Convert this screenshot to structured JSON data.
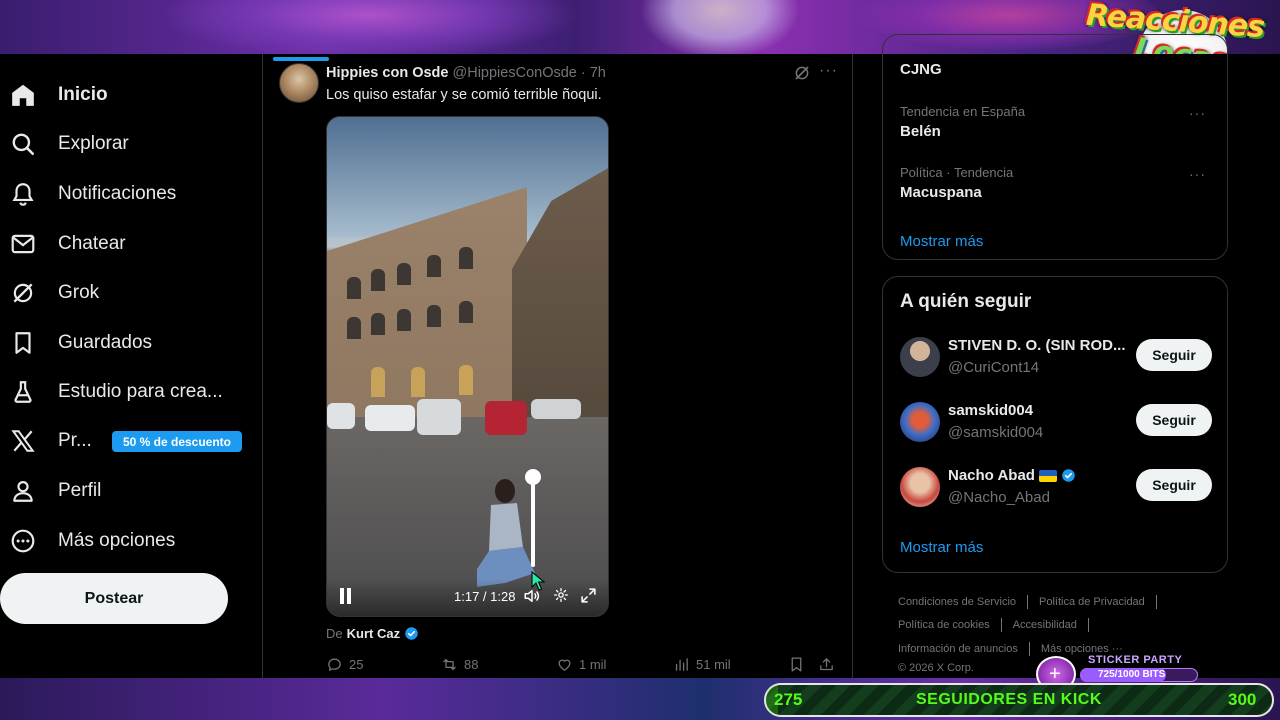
{
  "overlay": {
    "logo_line1": "Reacciones",
    "logo_line2": "Locas",
    "sticker_title": "STICKER PARTY",
    "sticker_progress_text": "725/1000 BITS",
    "sticker_progress": 0.725,
    "kick_start": "275",
    "kick_label": "SEGUIDORES EN KICK",
    "kick_goal": "300",
    "kick_progress": 0.0
  },
  "nav": {
    "items": [
      {
        "label": "Inicio",
        "icon": "home-icon"
      },
      {
        "label": "Explorar",
        "icon": "search-icon"
      },
      {
        "label": "Notificaciones",
        "icon": "bell-icon"
      },
      {
        "label": "Chatear",
        "icon": "mail-icon"
      },
      {
        "label": "Grok",
        "icon": "grok-icon"
      },
      {
        "label": "Guardados",
        "icon": "bookmark-icon"
      },
      {
        "label": "Estudio para crea...",
        "icon": "flask-icon"
      },
      {
        "label": "Pr...",
        "icon": "x-logo-icon"
      },
      {
        "label": "Perfil",
        "icon": "person-icon"
      },
      {
        "label": "Más opciones",
        "icon": "more-circle-icon"
      }
    ],
    "promo_badge": "50 % de descuento",
    "post_button": "Postear"
  },
  "tweet": {
    "author_name": "Hippies con Osde",
    "author_handle": "@HippiesConOsde",
    "age": "· 7h",
    "text": "Los quiso estafar y se comió terrible ñoqui.",
    "video_time": "1:17 / 1:28",
    "volume_level": 1.0,
    "credit_prefix": "De",
    "credit_name": "Kurt Caz",
    "replies": "25",
    "reposts": "88",
    "likes": "1 mil",
    "views": "51 mil"
  },
  "trends": {
    "partial_title": "CJNG",
    "items": [
      {
        "meta": "Tendencia en España",
        "title": "Belén"
      },
      {
        "meta": "Política · Tendencia",
        "title": "Macuspana"
      }
    ],
    "show_more": "Mostrar más"
  },
  "who_to_follow": {
    "title": "A quién seguir",
    "users": [
      {
        "name": "STIVEN D. O. (SIN ROD...",
        "handle": "@CuriCont14",
        "button": "Seguir"
      },
      {
        "name": "samskid004",
        "handle": "@samskid004",
        "button": "Seguir"
      },
      {
        "name": "Nacho Abad",
        "handle": "@Nacho_Abad",
        "button": "Seguir"
      }
    ],
    "show_more": "Mostrar más"
  },
  "footer": {
    "links_row1": [
      "Condiciones de Servicio",
      "Política de Privacidad"
    ],
    "links_row2": [
      "Política de cookies",
      "Accesibilidad"
    ],
    "links_row3": [
      "Información de anuncios",
      "Más opciones ···"
    ],
    "copyright": "© 2026 X Corp."
  },
  "colors": {
    "accent": "#1d9bf0",
    "background": "#000000",
    "text_primary": "#e7e9ea",
    "text_secondary": "#71767b",
    "kick_green": "#53fc18"
  }
}
